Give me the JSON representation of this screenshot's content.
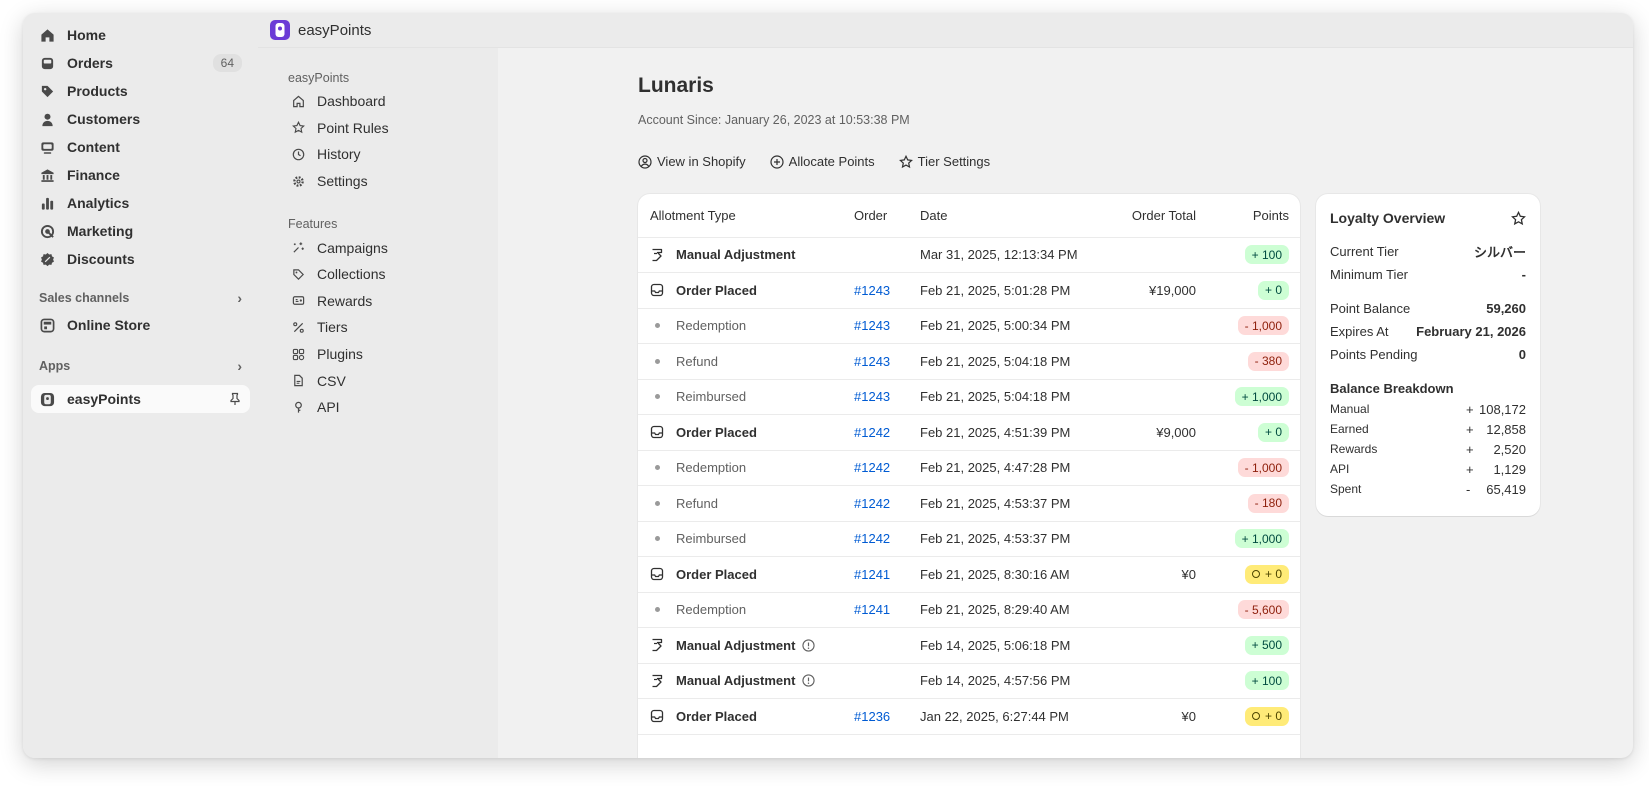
{
  "sidebar": {
    "items": [
      {
        "label": "Home",
        "icon": "home-icon"
      },
      {
        "label": "Orders",
        "icon": "inbox-icon",
        "badge": "64"
      },
      {
        "label": "Products",
        "icon": "tag-icon"
      },
      {
        "label": "Customers",
        "icon": "person-icon"
      },
      {
        "label": "Content",
        "icon": "image-icon"
      },
      {
        "label": "Finance",
        "icon": "bank-icon"
      },
      {
        "label": "Analytics",
        "icon": "bar-chart-icon"
      },
      {
        "label": "Marketing",
        "icon": "target-icon"
      },
      {
        "label": "Discounts",
        "icon": "discount-icon"
      }
    ],
    "sales_channels_label": "Sales channels",
    "online_store_label": "Online Store",
    "apps_label": "Apps",
    "easypoints_label": "easyPoints"
  },
  "appbar": {
    "title": "easyPoints"
  },
  "subnav": {
    "group1_label": "easyPoints",
    "group1": [
      {
        "label": "Dashboard",
        "icon": "home-outline-icon"
      },
      {
        "label": "Point Rules",
        "icon": "star-icon"
      },
      {
        "label": "History",
        "icon": "clock-icon"
      },
      {
        "label": "Settings",
        "icon": "gear-icon"
      }
    ],
    "group2_label": "Features",
    "group2": [
      {
        "label": "Campaigns",
        "icon": "sparkle-icon"
      },
      {
        "label": "Collections",
        "icon": "tag-outline-icon"
      },
      {
        "label": "Rewards",
        "icon": "reward-icon"
      },
      {
        "label": "Tiers",
        "icon": "tiers-icon"
      },
      {
        "label": "Plugins",
        "icon": "plugin-icon"
      },
      {
        "label": "CSV",
        "icon": "file-icon"
      },
      {
        "label": "API",
        "icon": "key-icon"
      }
    ]
  },
  "page": {
    "title": "Lunaris",
    "subtitle": "Account Since: January 26, 2023 at 10:53:38 PM",
    "actions": {
      "view_shopify": "View in Shopify",
      "allocate": "Allocate Points",
      "tier_settings": "Tier Settings"
    }
  },
  "table": {
    "headers": {
      "type": "Allotment Type",
      "order": "Order",
      "date": "Date",
      "total": "Order Total",
      "points": "Points"
    },
    "rows": [
      {
        "type": "Manual Adjustment",
        "kind": "manual",
        "order": "",
        "date": "Mar 31, 2025, 12:13:34 PM",
        "total": "",
        "points": "+ 100",
        "tone": "green",
        "info": false
      },
      {
        "type": "Order Placed",
        "kind": "order",
        "order": "#1243",
        "date": "Feb 21, 2025, 5:01:28 PM",
        "total": "¥19,000",
        "points": "+ 0",
        "tone": "green",
        "info": false
      },
      {
        "type": "Redemption",
        "kind": "sub",
        "order": "#1243",
        "date": "Feb 21, 2025, 5:00:34 PM",
        "total": "",
        "points": "- 1,000",
        "tone": "red",
        "info": false
      },
      {
        "type": "Refund",
        "kind": "sub",
        "order": "#1243",
        "date": "Feb 21, 2025, 5:04:18 PM",
        "total": "",
        "points": "- 380",
        "tone": "red",
        "info": false
      },
      {
        "type": "Reimbursed",
        "kind": "sub",
        "order": "#1243",
        "date": "Feb 21, 2025, 5:04:18 PM",
        "total": "",
        "points": "+ 1,000",
        "tone": "green",
        "info": false
      },
      {
        "type": "Order Placed",
        "kind": "order",
        "order": "#1242",
        "date": "Feb 21, 2025, 4:51:39 PM",
        "total": "¥9,000",
        "points": "+ 0",
        "tone": "green",
        "info": false
      },
      {
        "type": "Redemption",
        "kind": "sub",
        "order": "#1242",
        "date": "Feb 21, 2025, 4:47:28 PM",
        "total": "",
        "points": "- 1,000",
        "tone": "red",
        "info": false
      },
      {
        "type": "Refund",
        "kind": "sub",
        "order": "#1242",
        "date": "Feb 21, 2025, 4:53:37 PM",
        "total": "",
        "points": "- 180",
        "tone": "red",
        "info": false
      },
      {
        "type": "Reimbursed",
        "kind": "sub",
        "order": "#1242",
        "date": "Feb 21, 2025, 4:53:37 PM",
        "total": "",
        "points": "+ 1,000",
        "tone": "green",
        "info": false
      },
      {
        "type": "Order Placed",
        "kind": "order",
        "order": "#1241",
        "date": "Feb 21, 2025, 8:30:16 AM",
        "total": "¥0",
        "points": "+ 0",
        "tone": "yellow",
        "info": false
      },
      {
        "type": "Redemption",
        "kind": "sub",
        "order": "#1241",
        "date": "Feb 21, 2025, 8:29:40 AM",
        "total": "",
        "points": "- 5,600",
        "tone": "red",
        "info": false
      },
      {
        "type": "Manual Adjustment",
        "kind": "manual",
        "order": "",
        "date": "Feb 14, 2025, 5:06:18 PM",
        "total": "",
        "points": "+ 500",
        "tone": "green",
        "info": true
      },
      {
        "type": "Manual Adjustment",
        "kind": "manual",
        "order": "",
        "date": "Feb 14, 2025, 4:57:56 PM",
        "total": "",
        "points": "+ 100",
        "tone": "green",
        "info": true
      },
      {
        "type": "Order Placed",
        "kind": "order",
        "order": "#1236",
        "date": "Jan 22, 2025, 6:27:44 PM",
        "total": "¥0",
        "points": "+ 0",
        "tone": "yellow",
        "info": false
      }
    ]
  },
  "loyalty": {
    "title": "Loyalty Overview",
    "current_tier_label": "Current Tier",
    "current_tier": "シルバー",
    "minimum_tier_label": "Minimum Tier",
    "minimum_tier": "-",
    "point_balance_label": "Point Balance",
    "point_balance": "59,260",
    "expires_label": "Expires At",
    "expires": "February 21, 2026",
    "pending_label": "Points Pending",
    "pending": "0",
    "breakdown_title": "Balance Breakdown",
    "breakdown": [
      {
        "label": "Manual",
        "sign": "+",
        "value": "108,172"
      },
      {
        "label": "Earned",
        "sign": "+",
        "value": "12,858"
      },
      {
        "label": "Rewards",
        "sign": "+",
        "value": "2,520"
      },
      {
        "label": "API",
        "sign": "+",
        "value": "1,129"
      },
      {
        "label": "Spent",
        "sign": "-",
        "value": "65,419"
      }
    ]
  }
}
